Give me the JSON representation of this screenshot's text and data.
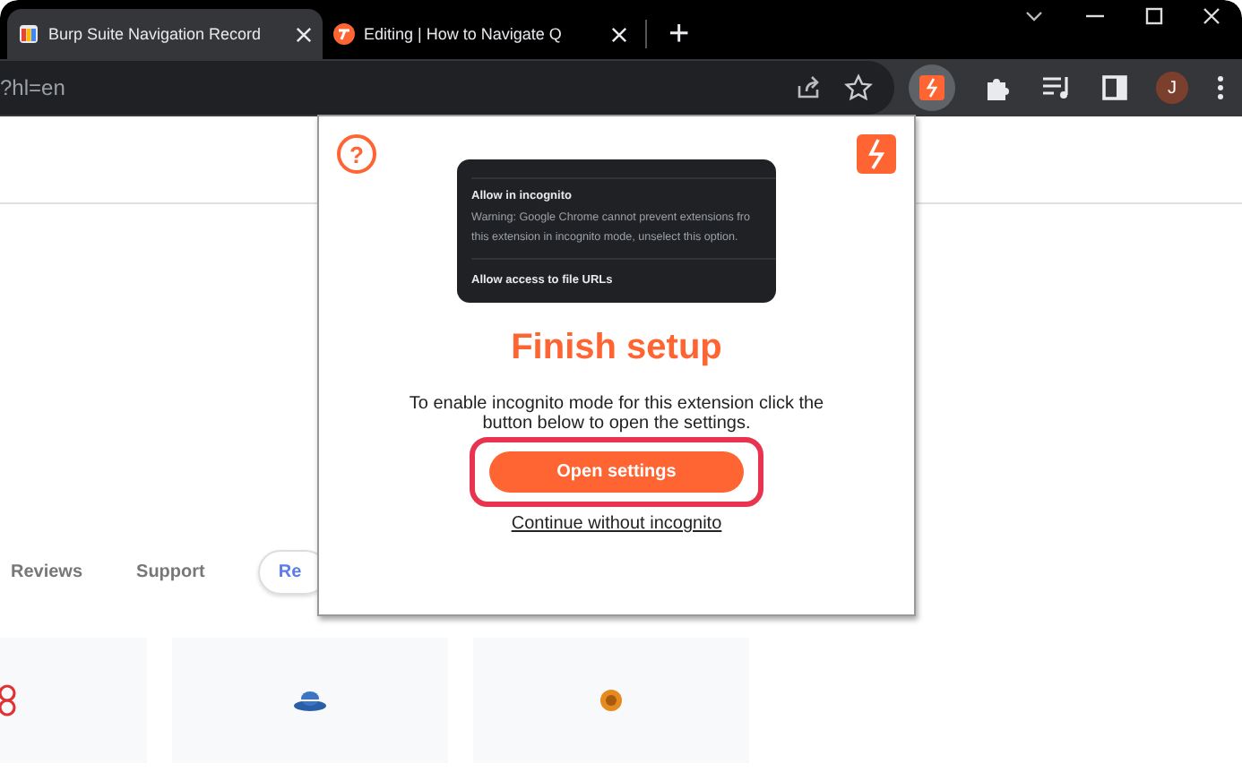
{
  "tabs": [
    {
      "title": "Burp Suite Navigation Record",
      "selected": true
    },
    {
      "title": "Editing | How to Navigate Q",
      "selected": false
    }
  ],
  "new_tab": "+",
  "address_bar": {
    "url": "?hl=en"
  },
  "profile": {
    "initial": "J"
  },
  "page": {
    "nav": [
      {
        "label": "Reviews",
        "selected": false
      },
      {
        "label": "Support",
        "selected": false
      },
      {
        "label": "Re",
        "selected": true
      }
    ]
  },
  "popup": {
    "help": "?",
    "screenshot": {
      "lines": [
        {
          "kind": "heading",
          "text": "Allow in incognito"
        },
        {
          "kind": "body",
          "text": "Warning: Google Chrome cannot prevent extensions fro"
        },
        {
          "kind": "body",
          "text": "this extension in incognito mode, unselect this option."
        },
        {
          "kind": "divider-heading",
          "text": "Allow access to file URLs"
        }
      ]
    },
    "title": "Finish setup",
    "description": "To enable incognito mode for this extension click the button below to open the settings.",
    "primary_button": {
      "label": "Open settings",
      "highlighted": true
    },
    "link": "Continue without incognito"
  }
}
